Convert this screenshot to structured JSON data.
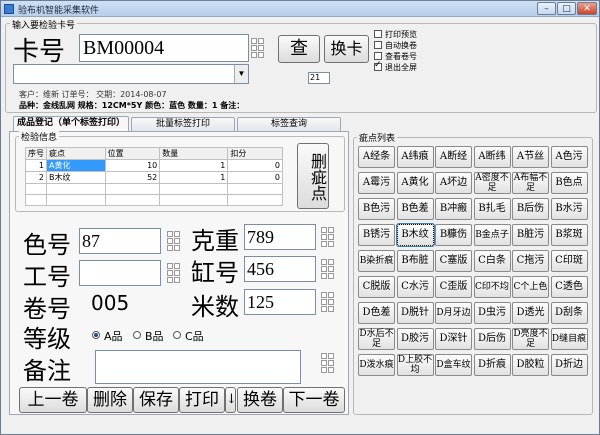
{
  "window": {
    "title": "验布机智能采集软件",
    "min": "–",
    "max": "□",
    "close": "✕"
  },
  "card": {
    "group_label": "输入要检验卡号",
    "label": "卡号",
    "value": "BM00004",
    "search_label": "查",
    "change_card_label": "换卡",
    "small_value": "21",
    "info_line1": "客户：维新   订单号：    交期：2014-08-07",
    "info_line2": "品种：金线乱网  规格：12CM*5Y  颜色：蓝色  数量：1  备注："
  },
  "options": [
    {
      "label": "打印预览",
      "checked": false
    },
    {
      "label": "自动换卷",
      "checked": false
    },
    {
      "label": "查看卷号",
      "checked": false
    },
    {
      "label": "退出全屏",
      "checked": true
    }
  ],
  "tabs": [
    {
      "label": "成品登记（单个标签打印）",
      "active": true
    },
    {
      "label": "批量标签打印",
      "active": false
    },
    {
      "label": "标签查询",
      "active": false
    }
  ],
  "inspect": {
    "group_label": "检验信息",
    "columns": [
      "序号",
      "疵点",
      "位置",
      "数量",
      "扣分"
    ],
    "rows": [
      {
        "no": "1",
        "defect": "A黄化",
        "position": "10",
        "qty": "1",
        "deduct": "0"
      },
      {
        "no": "2",
        "defect": "B木纹",
        "position": "52",
        "qty": "1",
        "deduct": "0"
      }
    ],
    "delete_label": "删疵点"
  },
  "form": {
    "color_label": "色号",
    "color_value": "87",
    "weight_label": "克重",
    "weight_value": "789",
    "worker_label": "工号",
    "worker_value": "",
    "vat_label": "缸号",
    "vat_value": "456",
    "roll_label": "卷号",
    "roll_value": "005",
    "meters_label": "米数",
    "meters_value": "125",
    "grade_label": "等级",
    "grades": [
      {
        "label": "A品",
        "checked": true
      },
      {
        "label": "B品",
        "checked": false
      },
      {
        "label": "C品",
        "checked": false
      }
    ],
    "remark_label": "备注",
    "remark_value": ""
  },
  "actions": {
    "prev_label": "上一卷",
    "delete_label": "删除",
    "save_label": "保存",
    "print_label": "打印",
    "arrow_label": "↓",
    "change_roll_label": "换卷",
    "next_label": "下一卷"
  },
  "defect_list": {
    "group_label": "疵点列表",
    "focused": "B木纹",
    "items": [
      "A经条",
      "A纬痕",
      "A断经",
      "A断纬",
      "A节丝",
      "A色污",
      "A霉污",
      "A黄化",
      "A坏边",
      "A密度不足",
      "A布幅不足",
      "B色点",
      "B色污",
      "B色差",
      "B冲瘢",
      "B扎毛",
      "B后伤",
      "B水污",
      "B锈污",
      "B木纹",
      "B糠伤",
      "B金点子",
      "B脏污",
      "B浆斑",
      "B染折痕",
      "B布脏",
      "C塞版",
      "C白条",
      "C拖污",
      "C印斑",
      "C脱版",
      "C水污",
      "C歪版",
      "C印不均",
      "C个上色",
      "C透色",
      "D色差",
      "D脱针",
      "D月牙边",
      "D虫污",
      "D透光",
      "D刮条",
      "D水后不足",
      "D胶污",
      "D深针",
      "D后伤",
      "D亮度不足",
      "D缝目痕",
      "D泼水痕",
      "D上胶不均",
      "D盒车纹",
      "D折痕",
      "D胶粒",
      "D折边"
    ]
  }
}
